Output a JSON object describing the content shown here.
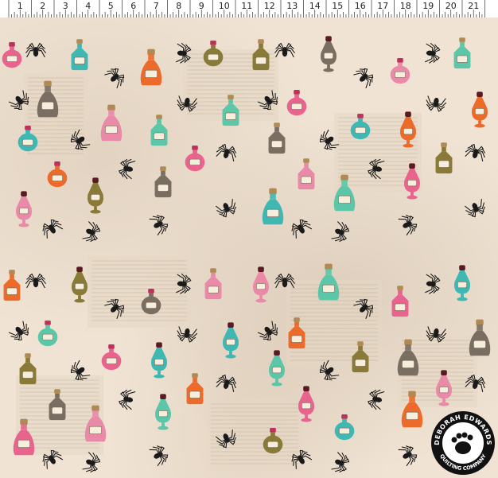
{
  "image": {
    "subject": "potion-bottle-fabric-print",
    "colors": {
      "background": "#efe2d2",
      "pink": "#e8648e",
      "teal": "#3fb8b4",
      "orange": "#ec6a2a",
      "olive": "#8a7a38",
      "grey": "#7a6e62",
      "cork": "#b08a54",
      "black": "#1a1a1a"
    }
  },
  "ruler": {
    "marks": [
      "1",
      "2",
      "3",
      "4",
      "5",
      "6",
      "7",
      "8",
      "9",
      "10",
      "11",
      "12",
      "13",
      "14",
      "15",
      "16",
      "17",
      "18",
      "19",
      "20",
      "21"
    ]
  },
  "logo": {
    "line1": "DEBORAH EDWARDS",
    "line2": "QUILTING COMPANY",
    "icon": "bear-paw-icon"
  }
}
